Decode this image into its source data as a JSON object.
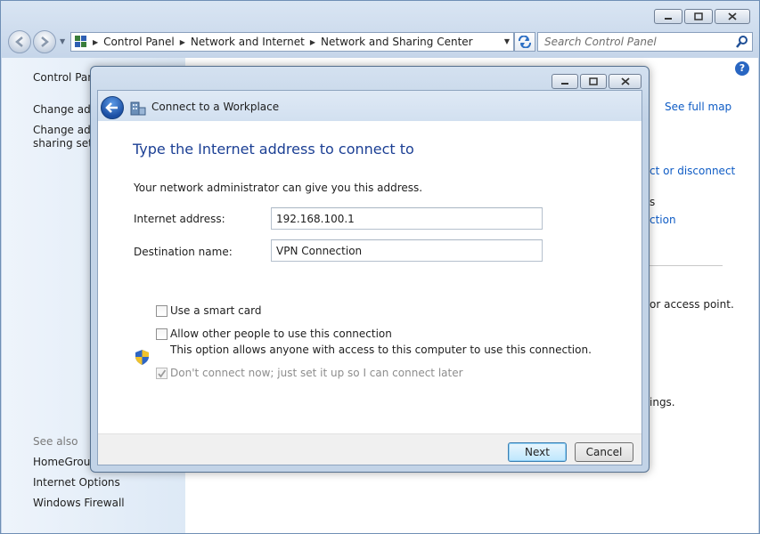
{
  "window": {
    "breadcrumbs": [
      "Control Panel",
      "Network and Internet",
      "Network and Sharing Center"
    ],
    "search_placeholder": "Search Control Panel"
  },
  "left_pane": {
    "home": "Control Panel Home",
    "tasks": [
      "Change adapter settings",
      "Change advanced sharing settings"
    ],
    "see_also_label": "See also",
    "see_also": [
      "HomeGroup",
      "Internet Options",
      "Windows Firewall"
    ]
  },
  "main_partial": {
    "see_full_map": "See full map",
    "connect_disconnect": "ct or disconnect",
    "line_s": "s",
    "line_ction": "ction",
    "access_point": "or access point.",
    "settings": "ings."
  },
  "dialog": {
    "title": "Connect to a Workplace",
    "heading": "Type the Internet address to connect to",
    "description": "Your network administrator can give you this address.",
    "internet_address_label": "Internet address:",
    "internet_address_value": "192.168.100.1",
    "destination_name_label": "Destination name:",
    "destination_name_value": "VPN Connection",
    "smart_card_label": "Use a smart card",
    "allow_others_label": "Allow other people to use this connection",
    "allow_others_note": "This option allows anyone with access to this computer to use this connection.",
    "dont_connect_label": "Don't connect now; just set it up so I can connect later",
    "smart_card_checked": false,
    "allow_others_checked": false,
    "dont_connect_checked": true,
    "dont_connect_enabled": false,
    "next_label": "Next",
    "cancel_label": "Cancel"
  }
}
